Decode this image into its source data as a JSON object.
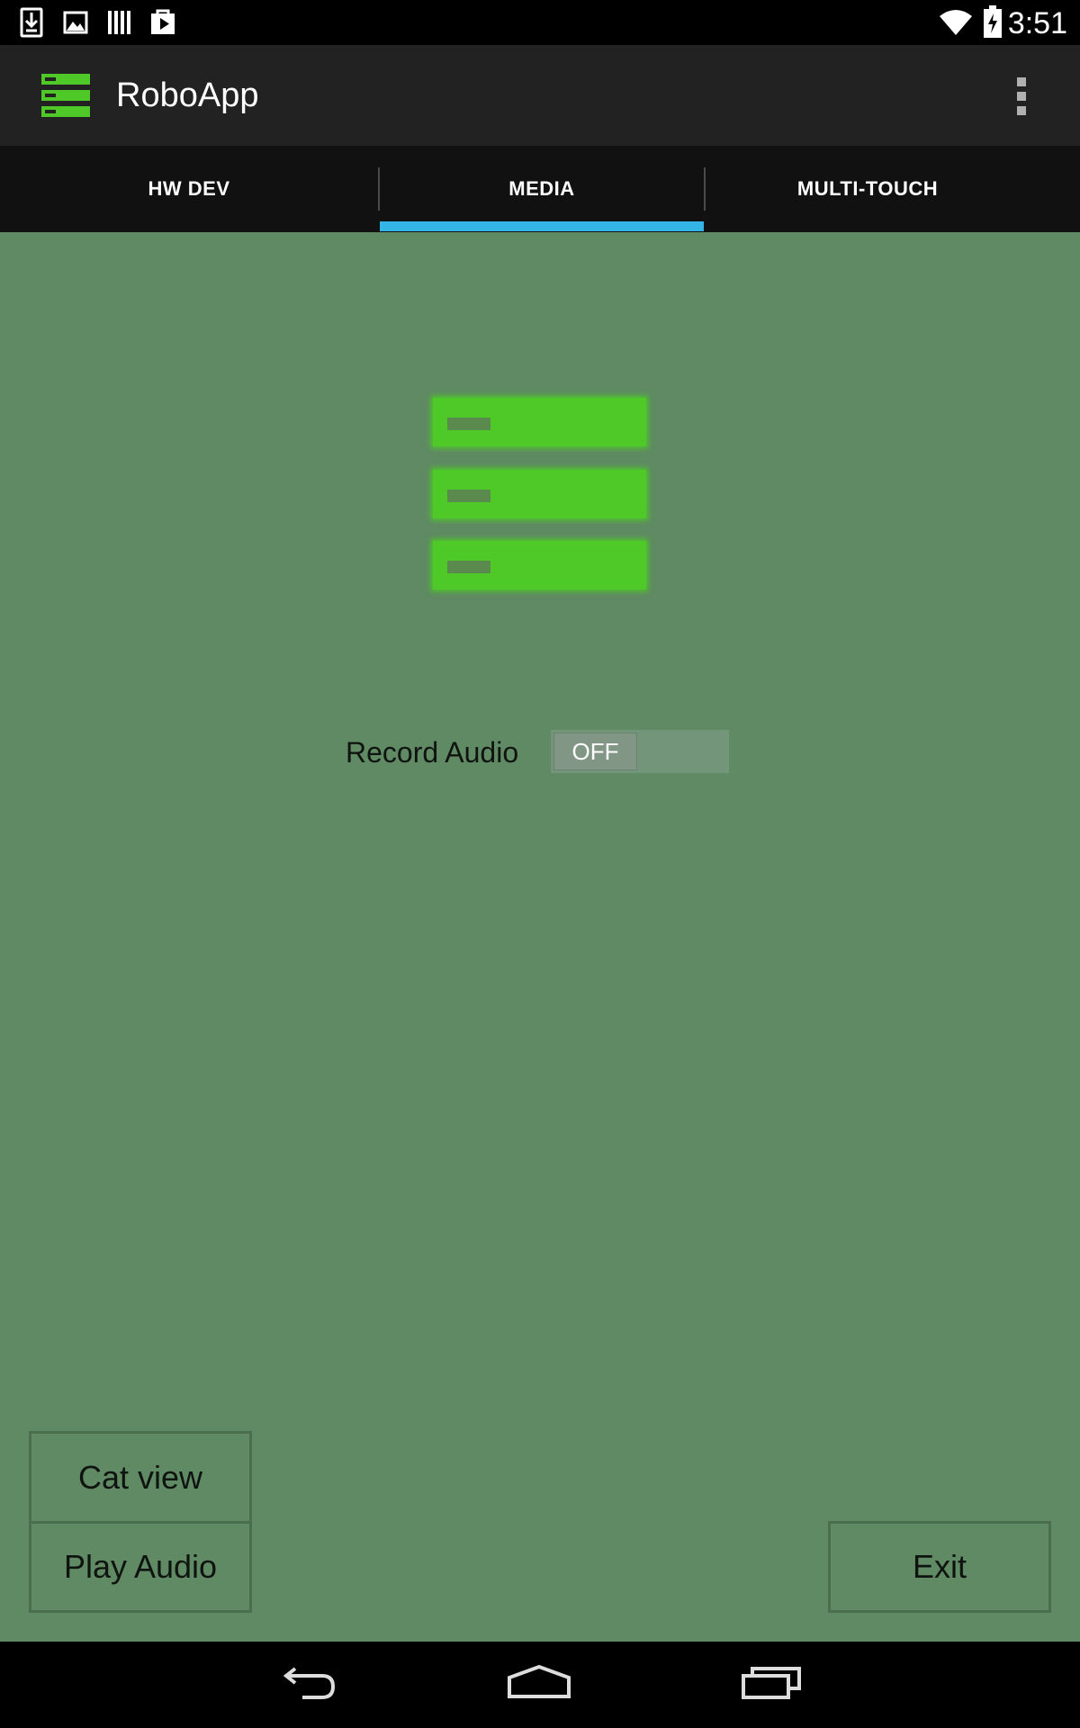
{
  "status_bar": {
    "time": "3:51",
    "left_icons": [
      "download-icon",
      "image-icon",
      "library-icon",
      "play-store-icon"
    ],
    "right_icons": [
      "wifi-icon",
      "battery-charging-icon"
    ]
  },
  "action_bar": {
    "title": "RoboApp",
    "logo_icon": "server-stack-icon",
    "overflow_icon": "overflow-menu-icon"
  },
  "tabs": [
    {
      "label": "HW DEV",
      "selected": false
    },
    {
      "label": "MEDIA",
      "selected": true
    },
    {
      "label": "MULTI-TOUCH",
      "selected": false
    }
  ],
  "content": {
    "logo_icon": "server-stack-icon",
    "record_audio": {
      "label": "Record Audio",
      "switch_state": "OFF"
    },
    "buttons": {
      "cat_view": "Cat view",
      "play_audio": "Play Audio",
      "exit": "Exit"
    }
  },
  "nav_bar": {
    "icons": [
      "back-icon",
      "home-icon",
      "recent-apps-icon"
    ]
  },
  "colors": {
    "content_background": "#5f8a63",
    "accent_green": "#4ec928",
    "tab_indicator": "#33b5e5",
    "action_bar": "#222222",
    "tab_bar": "#111111"
  }
}
